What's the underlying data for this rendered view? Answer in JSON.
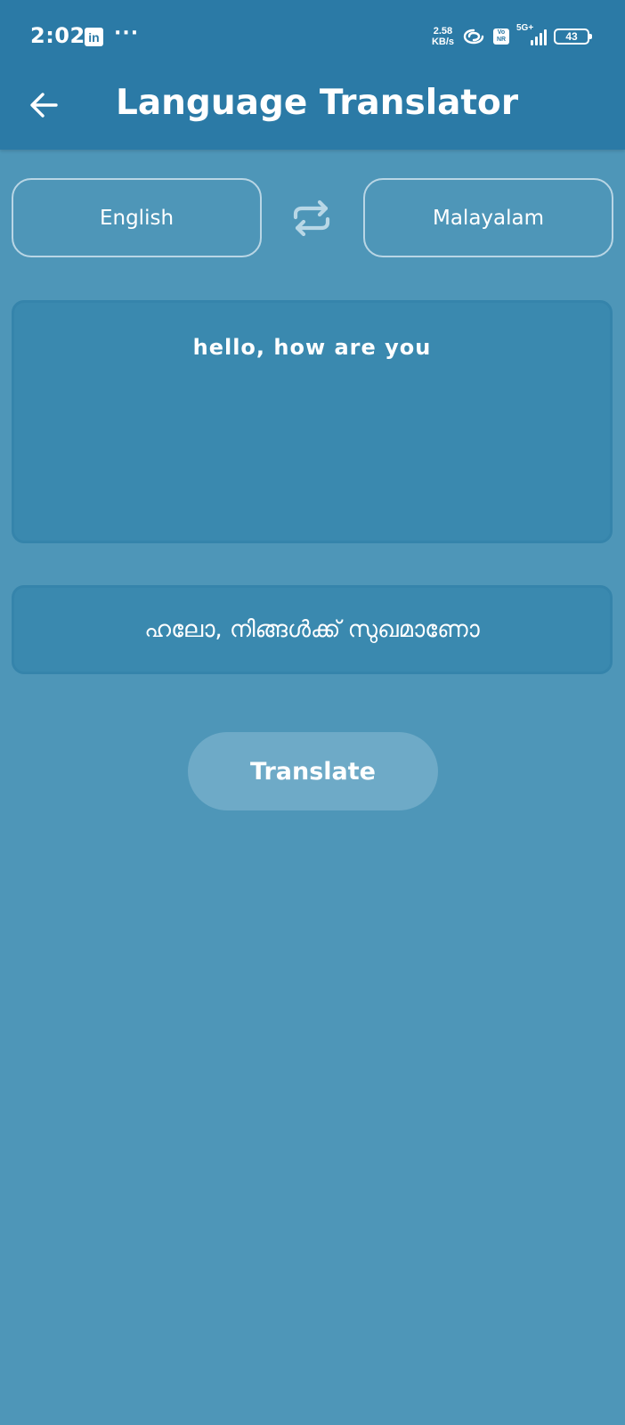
{
  "status_bar": {
    "time": "2:02",
    "app_icon": "linkedin-icon",
    "app_icon_text": "in",
    "more": "···",
    "speed_value": "2.58",
    "speed_unit": "KB/s",
    "volte_line1": "Vo",
    "volte_line2": "NR",
    "network": "5G+",
    "battery": "43"
  },
  "toolbar": {
    "back_icon": "arrow-left-icon",
    "title": "Language Translator"
  },
  "languages": {
    "source": "English",
    "swap_icon": "swap-arrows-icon",
    "target": "Malayalam"
  },
  "input": {
    "text": "hello, how are you"
  },
  "output": {
    "text": "ഹലോ, നിങ്ങൾക്ക് സുഖമാണോ"
  },
  "actions": {
    "translate_label": "Translate"
  },
  "colors": {
    "background": "#4e96b8",
    "app_bar": "#2b7aa6",
    "panel": "#3a89af",
    "button": "#6eaac7",
    "text": "#ffffff"
  }
}
